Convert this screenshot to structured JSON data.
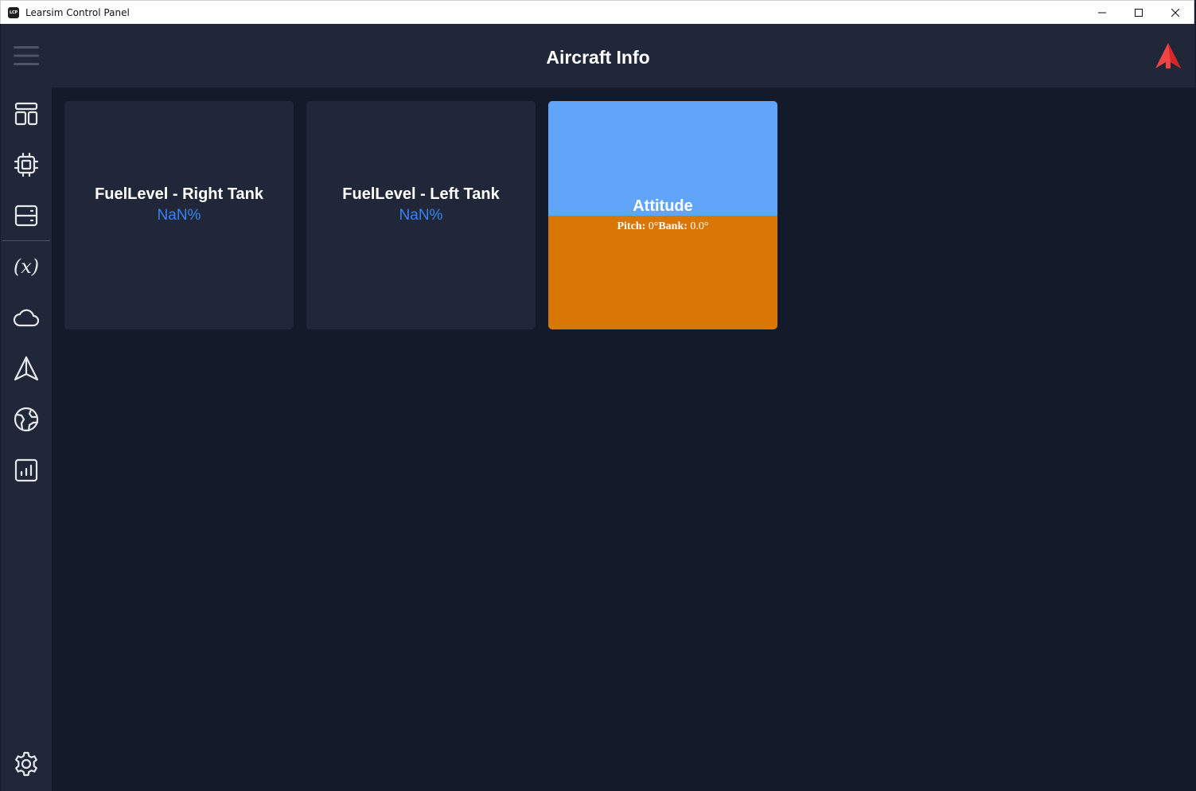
{
  "window": {
    "icon_text": "LCP",
    "title": "Learsim Control Panel"
  },
  "header": {
    "title": "Aircraft Info"
  },
  "sidebar": {
    "items": [
      {
        "icon": "dashboard-icon"
      },
      {
        "icon": "cpu-icon"
      },
      {
        "icon": "server-icon"
      },
      {
        "icon": "variable-icon"
      },
      {
        "icon": "cloud-icon"
      },
      {
        "icon": "navigation-icon"
      },
      {
        "icon": "globe-icon"
      },
      {
        "icon": "chart-icon"
      }
    ],
    "settings_icon": "gear-icon"
  },
  "cards": [
    {
      "title": "FuelLevel - Right Tank",
      "value": "NaN%"
    },
    {
      "title": "FuelLevel - Left Tank",
      "value": "NaN%"
    }
  ],
  "attitude": {
    "title": "Attitude",
    "pitch_label": "Pitch:",
    "pitch_value": "0°",
    "bank_label": "Bank:",
    "bank_value": "0.0°",
    "sky_color": "#60a5fa",
    "ground_color": "#d97706"
  },
  "colors": {
    "background": "#131a29",
    "panel": "#1f2738",
    "accent_blue": "#3b82f6",
    "brand_red": "#ef4444"
  }
}
